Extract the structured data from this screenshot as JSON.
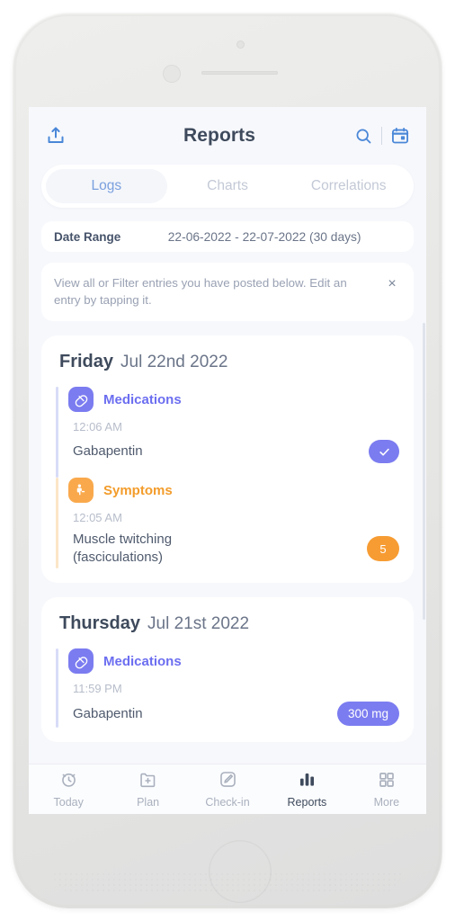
{
  "header": {
    "title": "Reports",
    "share_icon": "upload-share-icon",
    "search_icon": "search-icon",
    "calendar_icon": "calendar-icon"
  },
  "tabs": [
    {
      "label": "Logs",
      "active": true
    },
    {
      "label": "Charts",
      "active": false
    },
    {
      "label": "Correlations",
      "active": false
    }
  ],
  "date_range": {
    "label": "Date Range",
    "value": "22-06-2022 - 22-07-2022 (30 days)"
  },
  "info_banner": {
    "text": "View all or Filter entries you have posted below. Edit an entry by tapping it.",
    "close_label": "×"
  },
  "days": [
    {
      "day_name": "Friday",
      "day_date": "Jul 22nd 2022",
      "entries": [
        {
          "category": "Medications",
          "icon": "pill-capsule-icon",
          "time": "12:06 AM",
          "name": "Gabapentin",
          "badge_type": "check",
          "badge_text": "✓",
          "accent": "#7b7cf0"
        },
        {
          "category": "Symptoms",
          "icon": "body-symptom-icon",
          "time": "12:05 AM",
          "name": "Muscle twitching (fasciculations)",
          "badge_type": "count",
          "badge_text": "5",
          "accent": "#f79c33"
        }
      ]
    },
    {
      "day_name": "Thursday",
      "day_date": "Jul 21st 2022",
      "entries": [
        {
          "category": "Medications",
          "icon": "pill-capsule-icon",
          "time": "11:59 PM",
          "name": "Gabapentin",
          "badge_type": "dose",
          "badge_text": "300 mg",
          "accent": "#7b7cf0"
        }
      ]
    }
  ],
  "bottom_nav": [
    {
      "label": "Today",
      "icon": "alarm-clock-icon",
      "active": false
    },
    {
      "label": "Plan",
      "icon": "folder-plus-icon",
      "active": false
    },
    {
      "label": "Check-in",
      "icon": "pencil-square-icon",
      "active": false
    },
    {
      "label": "Reports",
      "icon": "bar-chart-icon",
      "active": true
    },
    {
      "label": "More",
      "icon": "grid-squares-icon",
      "active": false
    }
  ],
  "colors": {
    "accent_blue": "#4a87d8",
    "accent_purple": "#7b7cf0",
    "accent_orange": "#f79c33",
    "text_dark": "#3e4a5c",
    "screen_bg": "#f7f8fc"
  }
}
